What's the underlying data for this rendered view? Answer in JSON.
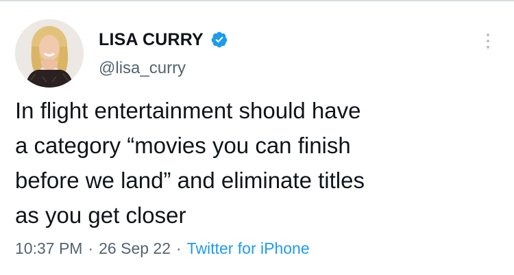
{
  "tweet": {
    "author": {
      "display_name": "LISA CURRY",
      "handle": "@lisa_curry",
      "verified": true,
      "avatar_icon": "profile-photo"
    },
    "more_icon": "more-vertical-icon",
    "text": "In flight entertainment should have\na category “movies you can finish\nbefore we land” and eliminate titles\nas you get closer",
    "meta": {
      "time": "10:37 PM",
      "separator": "·",
      "date": "26 Sep 22",
      "source": "Twitter for iPhone"
    }
  },
  "colors": {
    "text": "#0f1419",
    "secondary": "#536471",
    "link": "#1d9bf0",
    "verified": "#1d9bf0"
  }
}
